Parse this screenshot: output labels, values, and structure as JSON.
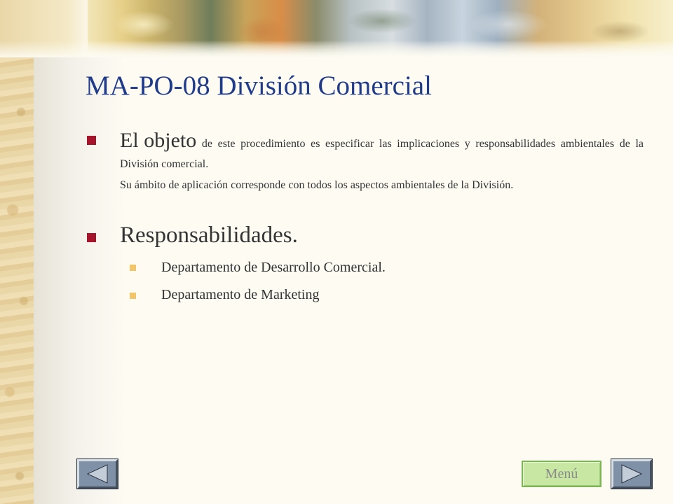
{
  "slide": {
    "title": "MA-PO-08 División Comercial",
    "intro": {
      "lead_word_1": "El",
      "lead_word_2": "objeto",
      "text": "de este procedimiento es especificar las implicaciones y responsabilidades ambientales de la División comercial."
    },
    "scope_text": "Su ámbito de aplicación corresponde con todos los aspectos ambientales de la División.",
    "responsibilities": {
      "heading": "Responsabilidades.",
      "items": [
        "Departamento de Desarrollo Comercial.",
        "Departamento de Marketing"
      ]
    }
  },
  "controls": {
    "menu_label": "Menú",
    "prev_icon": "triangle-left-icon",
    "next_icon": "triangle-right-icon"
  },
  "colors": {
    "title": "#1f3b8a",
    "bullet_primary": "#a6142c",
    "bullet_secondary": "#f3c56b",
    "menu_button_bg": "#c7e7a3",
    "nav_button_bg": "#7f91a6"
  }
}
